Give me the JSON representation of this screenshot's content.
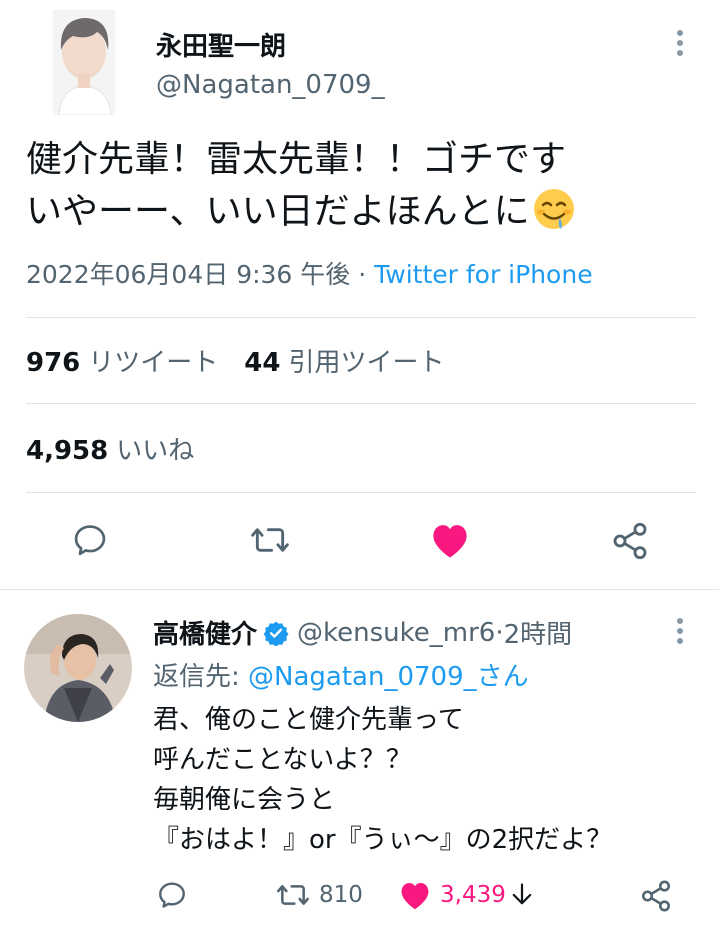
{
  "main_tweet": {
    "author_name": "永田聖一朗",
    "author_handle": "@Nagatan_0709_",
    "text_lines": [
      "健介先輩！雷太先輩！！ゴチです",
      "いやーー、いい日だよほんとに"
    ],
    "timestamp": "2022年06月04日 9:36 午後",
    "separator": " · ",
    "source": "Twitter for iPhone",
    "retweets_count": "976",
    "retweets_label": "リツイート",
    "quotes_count": "44",
    "quotes_label": "引用ツイート",
    "likes_count": "4,958",
    "likes_label": "いいね",
    "liked": true
  },
  "reply_tweet": {
    "author_name": "高橋健介",
    "author_handle": "@kensuke_mr6",
    "separator": " · ",
    "time_ago": "2時間",
    "reply_prefix": "返信先: ",
    "reply_mention": "@Nagatan_0709_さん",
    "text_lines": [
      "君、俺のこと健介先輩って",
      "呼んだことないよ？？",
      "毎朝俺に会うと",
      "『おはよ！』or『うぃ〜』の2択だよ？"
    ],
    "retweets_count": "810",
    "likes_count": "3,439",
    "liked": true
  },
  "icons": {
    "reply": "reply-icon",
    "retweet": "retweet-icon",
    "like": "heart-icon",
    "share": "share-icon",
    "more": "more-options-icon",
    "verified": "verified-badge-icon",
    "emoji": "drooling-face-emoji"
  },
  "colors": {
    "text": "#0f1419",
    "secondary": "#536471",
    "link": "#1d9bf0",
    "like": "#f91880",
    "divider": "#e1e5e8"
  }
}
